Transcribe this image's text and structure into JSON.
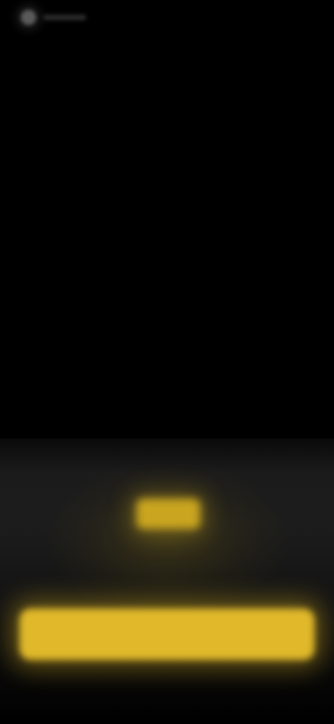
{
  "app": {
    "logo_icon": "app-logo-icon",
    "logo_text": ""
  },
  "promo": {
    "badge_text": "",
    "headline": ""
  },
  "cta": {
    "label": ""
  },
  "colors": {
    "background": "#000000",
    "panel": "#1c1c1c",
    "accent": "#e0b82a",
    "text": "#d8d8d8"
  }
}
